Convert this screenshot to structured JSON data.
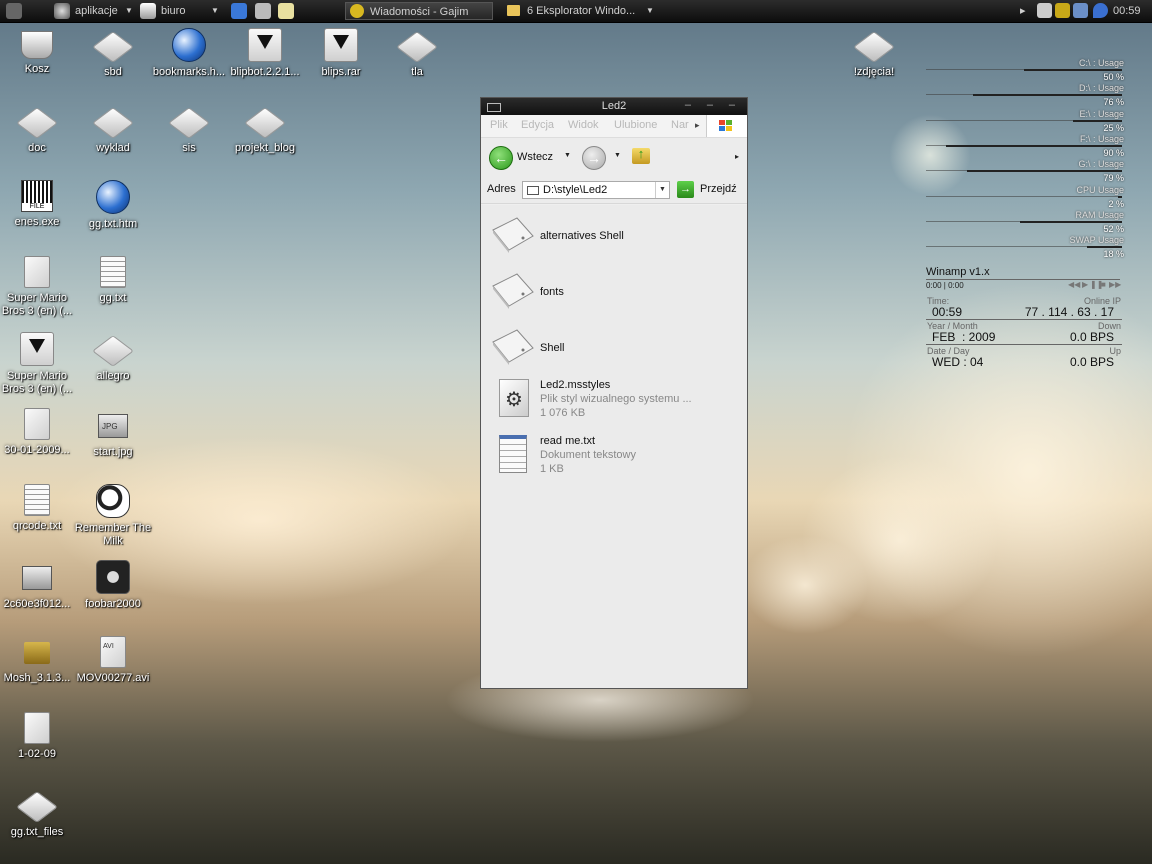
{
  "taskbar": {
    "menu1": "aplikacje",
    "menu2": "biuro",
    "task1": "Wiadomości - Gajim",
    "task2": "6 Eksplorator Windo...",
    "clock": "00:59"
  },
  "desktop": {
    "icons": [
      {
        "label": "Kosz"
      },
      {
        "label": "sbd"
      },
      {
        "label": "bookmarks.h..."
      },
      {
        "label": "blipbot.2.2.1..."
      },
      {
        "label": "blips.rar"
      },
      {
        "label": "tla"
      },
      {
        "label": "doc"
      },
      {
        "label": "wyklad"
      },
      {
        "label": "sis"
      },
      {
        "label": "projekt_blog"
      },
      {
        "label": "enes.exe"
      },
      {
        "label": "gg.txt.htm"
      },
      {
        "label": "Super Mario Bros 3 (en) (..."
      },
      {
        "label": "gg.txt"
      },
      {
        "label": "Super Mario Bros 3 (en) (..."
      },
      {
        "label": "allegro"
      },
      {
        "label": "30-01-2009..."
      },
      {
        "label": "start.jpg"
      },
      {
        "label": "qrcode.txt"
      },
      {
        "label": "Remember The Milk"
      },
      {
        "label": "2c60e3f012..."
      },
      {
        "label": "foobar2000"
      },
      {
        "label": "Mosh_3.1.3..."
      },
      {
        "label": "MOV00277.avi"
      },
      {
        "label": "1-02-09"
      },
      {
        "label": "gg.txt_files"
      },
      {
        "label": "!zdjęcia!"
      }
    ],
    "start_badge": "JPG",
    "mov_badge": "AVI",
    "barcode_text": "FILE"
  },
  "window": {
    "title": "Led2",
    "menu": [
      "Plik",
      "Edycja",
      "Widok",
      "Ulubione",
      "Nar"
    ],
    "back_label": "Wstecz",
    "address_label": "Adres",
    "address_value": "D:\\style\\Led2",
    "go_label": "Przejdź",
    "items": [
      {
        "name": "alternatives Shell"
      },
      {
        "name": "fonts"
      },
      {
        "name": "Shell"
      },
      {
        "name": "Led2.msstyles",
        "type": "Plik styl wizualnego systemu ...",
        "size": "1 076 KB"
      },
      {
        "name": "read me.txt",
        "type": "Dokument tekstowy",
        "size": "1 KB"
      }
    ]
  },
  "meters": [
    {
      "label": "C:\\ : Usage",
      "value": "50 %",
      "percent": 50
    },
    {
      "label": "D:\\ : Usage",
      "value": "76 %",
      "percent": 76
    },
    {
      "label": "E:\\ : Usage",
      "value": "25 %",
      "percent": 25
    },
    {
      "label": "F:\\ : Usage",
      "value": "90 %",
      "percent": 90
    },
    {
      "label": "G:\\ : Usage",
      "value": "79 %",
      "percent": 79
    },
    {
      "label": "CPU Usage",
      "value": "2 %",
      "percent": 2
    },
    {
      "label": "RAM Usage",
      "value": "52 %",
      "percent": 52
    },
    {
      "label": "SWAP Usage",
      "value": "18 %",
      "percent": 18
    }
  ],
  "winamp": {
    "title": "Winamp v1.x",
    "time": "0:00 | 0:00"
  },
  "sysinfo": {
    "time_label": "Time:",
    "time_value": "00:59",
    "ip_label": "Online IP",
    "ip_value": "77 . 114 . 63 . 17",
    "ym_label": "Year / Month",
    "ym_value": "FEB  : 2009",
    "down_label": "Down",
    "down_value": "0.0 BPS",
    "dd_label": "Date / Day",
    "dd_value": "WED : 04",
    "up_label": "Up",
    "up_value": "0.0 BPS"
  }
}
